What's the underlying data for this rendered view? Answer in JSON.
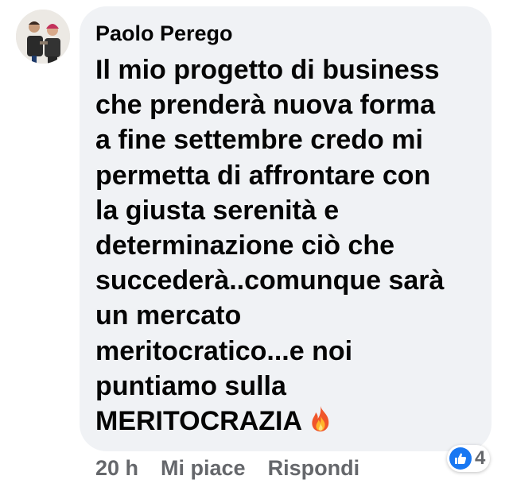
{
  "comment": {
    "author": "Paolo Perego",
    "lines": [
      "Il mio progetto di business",
      "che prenderà nuova  forma",
      "a fine settembre credo mi",
      "permetta di affrontare con",
      "la giusta serenità e",
      "determinazione ciò che",
      "succederà..comunque sarà",
      "un mercato",
      "meritocratico...e noi",
      "puntiamo sulla",
      "MERITOCRAZIA"
    ],
    "emoji": "fire-icon"
  },
  "actions": {
    "timestamp": "20 h",
    "like_label": "Mi piace",
    "reply_label": "Rispondi"
  },
  "reactions": {
    "icon": "thumbs-up-icon",
    "count": "4",
    "color": "#1877f2"
  },
  "colors": {
    "bubble": "#f0f2f5",
    "text": "#050505",
    "secondary": "#65676b"
  }
}
